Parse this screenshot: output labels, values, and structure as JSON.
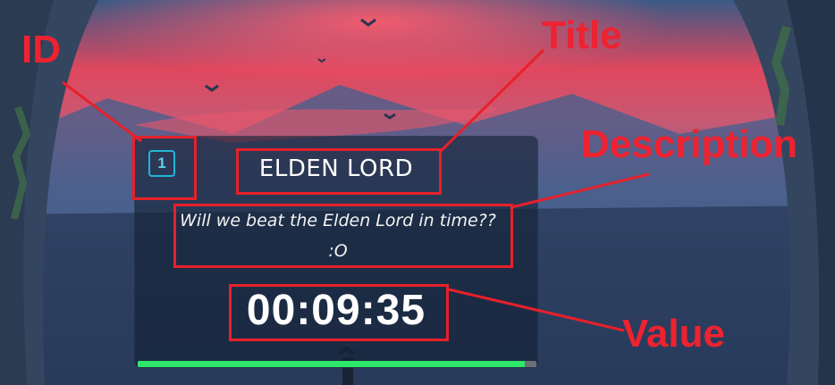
{
  "card": {
    "id": "1",
    "title": "ELDEN LORD",
    "description": "Will we beat the Elden Lord in time?? :O",
    "value": "00:09:35",
    "progress_fraction": 0.97,
    "colors": {
      "progress_fill": "#2ee86a",
      "progress_track": "#6b6f78",
      "id_border": "#1fb6d6"
    }
  },
  "annotations": {
    "id_label": "ID",
    "title_label": "Title",
    "description_label": "Description",
    "value_label": "Value",
    "color": "#ee2230"
  }
}
